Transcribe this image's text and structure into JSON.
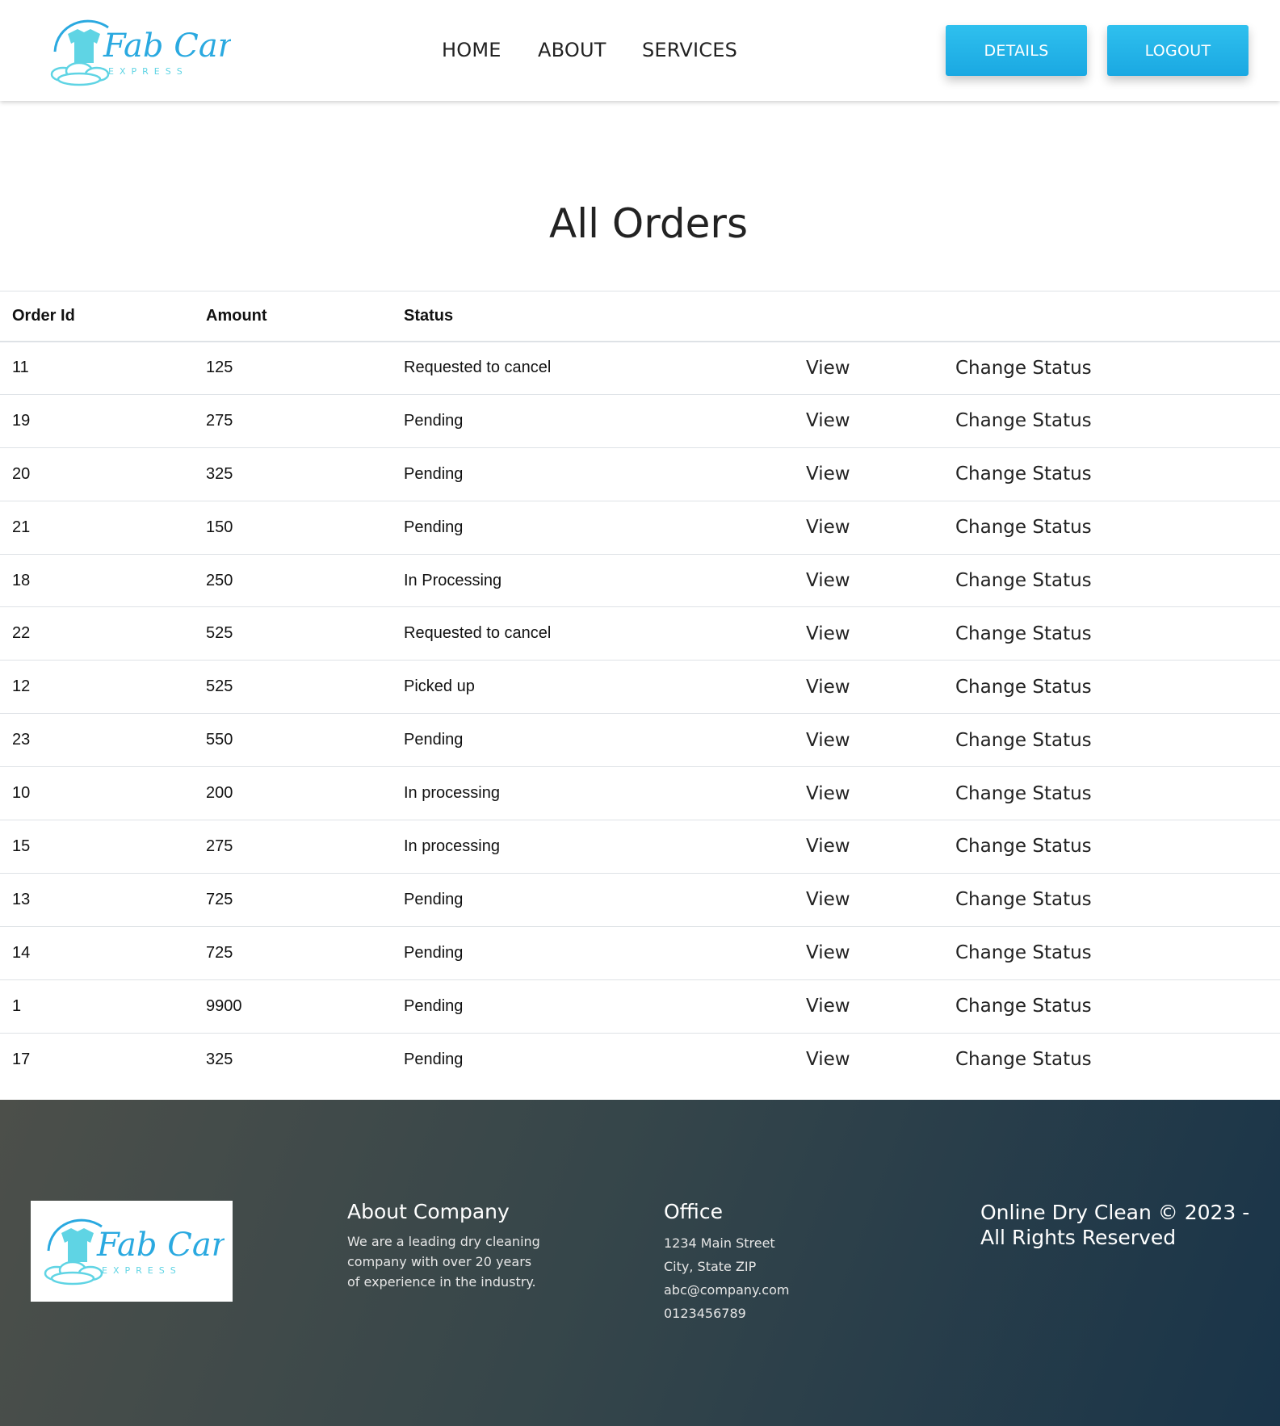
{
  "brand": {
    "name": "Fab Care",
    "tagline": "EXPRESS"
  },
  "nav": {
    "home": "HOME",
    "about": "ABOUT",
    "services": "SERVICES"
  },
  "buttons": {
    "details": "DETAILS",
    "logout": "LOGOUT"
  },
  "main": {
    "title": "All Orders",
    "columns": [
      "Order Id",
      "Amount",
      "Status",
      "",
      ""
    ],
    "view_label": "View",
    "change_status_label": "Change Status",
    "orders": [
      {
        "id": "11",
        "amount": "125",
        "status": "Requested to cancel"
      },
      {
        "id": "19",
        "amount": "275",
        "status": "Pending"
      },
      {
        "id": "20",
        "amount": "325",
        "status": "Pending"
      },
      {
        "id": "21",
        "amount": "150",
        "status": "Pending"
      },
      {
        "id": "18",
        "amount": "250",
        "status": "In Processing"
      },
      {
        "id": "22",
        "amount": "525",
        "status": "Requested to cancel"
      },
      {
        "id": "12",
        "amount": "525",
        "status": "Picked up"
      },
      {
        "id": "23",
        "amount": "550",
        "status": "Pending"
      },
      {
        "id": "10",
        "amount": "200",
        "status": "In processing"
      },
      {
        "id": "15",
        "amount": "275",
        "status": "In processing"
      },
      {
        "id": "13",
        "amount": "725",
        "status": "Pending"
      },
      {
        "id": "14",
        "amount": "725",
        "status": "Pending"
      },
      {
        "id": "1",
        "amount": "9900",
        "status": "Pending"
      },
      {
        "id": "17",
        "amount": "325",
        "status": "Pending"
      }
    ]
  },
  "footer": {
    "about_title": "About Company",
    "about_text": "We are a leading dry cleaning company with over 20 years of experience in the industry.",
    "office_title": "Office",
    "office_lines": [
      "1234 Main Street",
      "City, State ZIP",
      "abc@company.com",
      "0123456789"
    ],
    "copyright": "Online Dry Clean © 2023 - All Rights Reserved"
  },
  "colors": {
    "accent": "#1eaee6",
    "logo_teal": "#5fd4e4",
    "logo_blue": "#2aa9e0"
  }
}
